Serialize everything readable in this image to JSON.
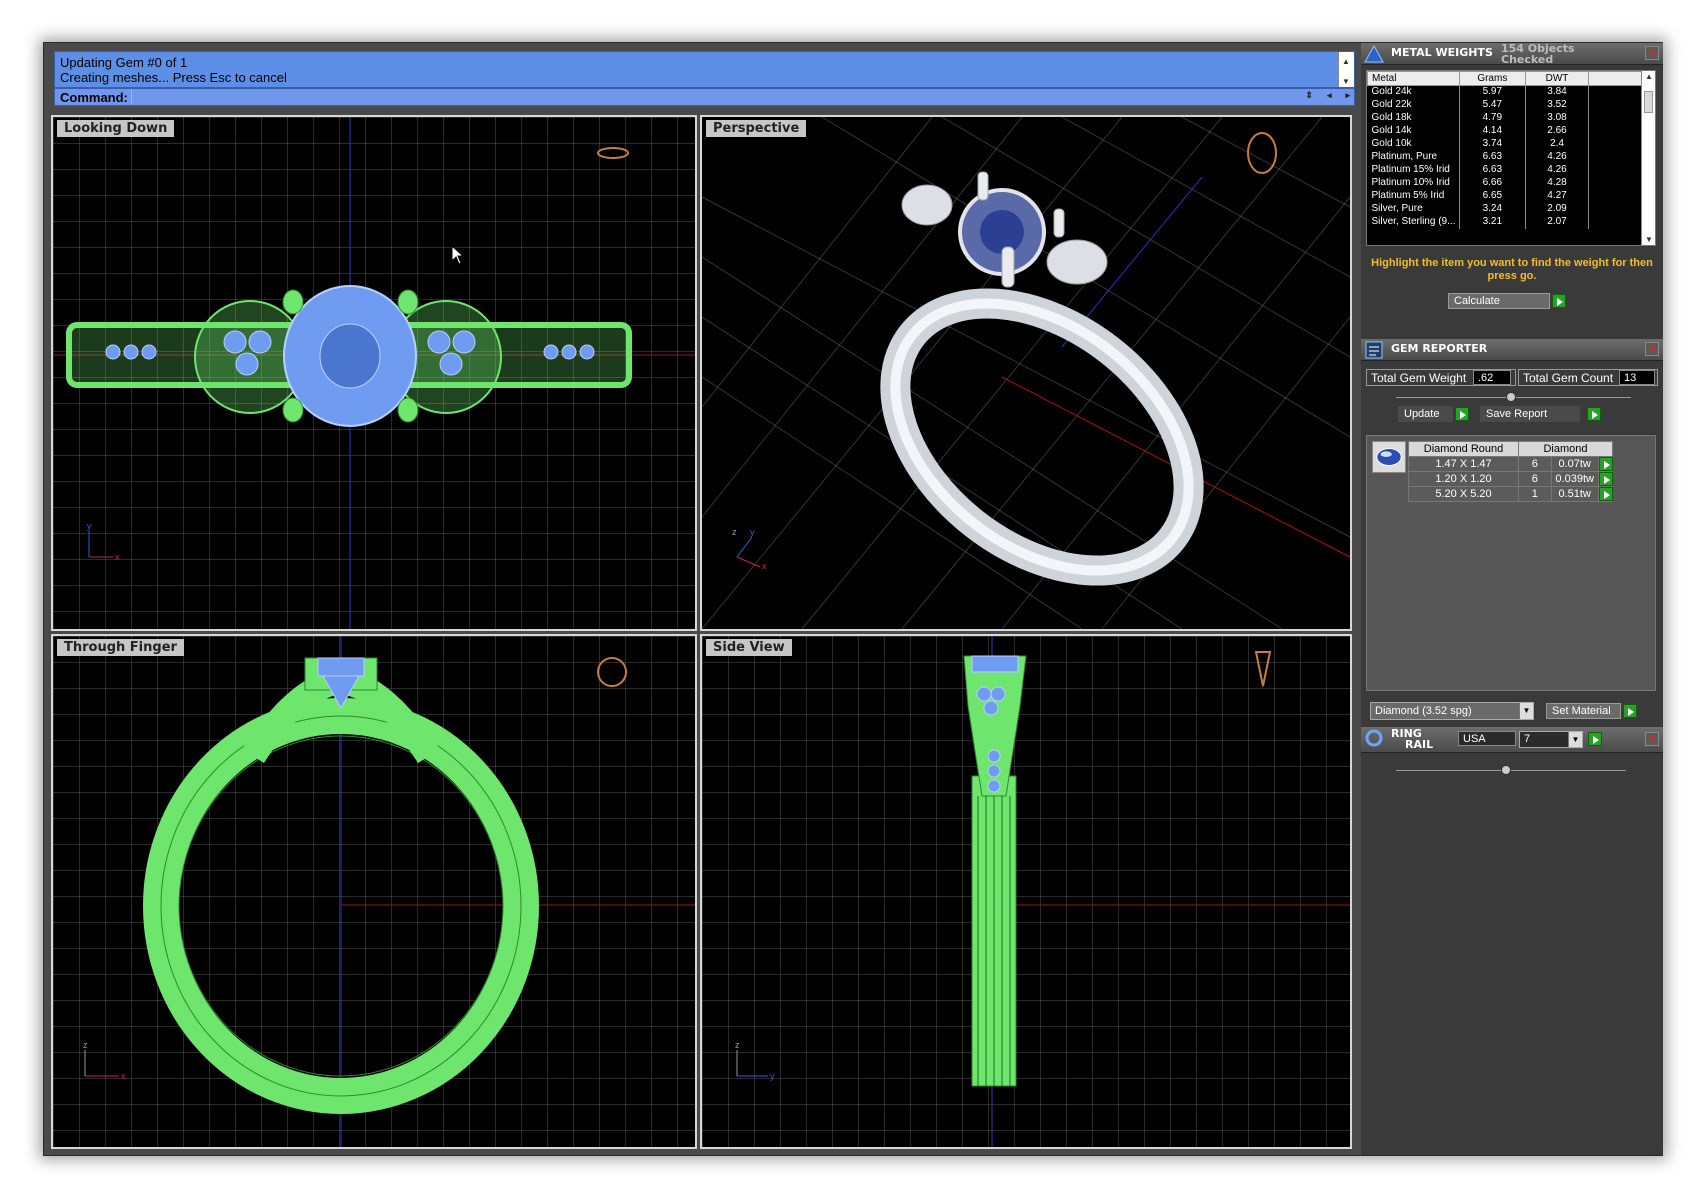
{
  "command": {
    "history": [
      "Updating Gem #0 of 1",
      "Creating meshes... Press Esc to cancel"
    ],
    "prompt": "Command:"
  },
  "viewports": {
    "top_left": "Looking Down",
    "top_right": "Perspective",
    "bottom_left": "Through Finger",
    "bottom_right": "Side View"
  },
  "axes": {
    "x": "x",
    "y": "y",
    "z": "z"
  },
  "metal_weights": {
    "title": "METAL WEIGHTS",
    "subtitle": [
      "154 Objects",
      "Checked"
    ],
    "columns": [
      "Metal",
      "Grams",
      "DWT"
    ],
    "rows": [
      {
        "metal": "Gold 24k",
        "grams": "5.97",
        "dwt": "3.84"
      },
      {
        "metal": "Gold 22k",
        "grams": "5.47",
        "dwt": "3.52"
      },
      {
        "metal": "Gold 18k",
        "grams": "4.79",
        "dwt": "3.08"
      },
      {
        "metal": "Gold 14k",
        "grams": "4.14",
        "dwt": "2.66"
      },
      {
        "metal": "Gold 10k",
        "grams": "3.74",
        "dwt": "2.4"
      },
      {
        "metal": "Platinum, Pure",
        "grams": "6.63",
        "dwt": "4.26"
      },
      {
        "metal": "Platinum 15% Irid",
        "grams": "6.63",
        "dwt": "4.26"
      },
      {
        "metal": "Platinum 10% Irid",
        "grams": "6.66",
        "dwt": "4.28"
      },
      {
        "metal": "Platinum 5% Irid",
        "grams": "6.65",
        "dwt": "4.27"
      },
      {
        "metal": "Silver, Pure",
        "grams": "3.24",
        "dwt": "2.09"
      },
      {
        "metal": "Silver, Sterling (9...",
        "grams": "3.21",
        "dwt": "2.07"
      }
    ],
    "hint": "Highlight the item you want to find the weight for then press go.",
    "calculate_label": "Calculate"
  },
  "gem_reporter": {
    "title": "GEM REPORTER",
    "total_weight_label": "Total Gem Weight",
    "total_weight_value": ".62",
    "total_count_label": "Total Gem Count",
    "total_count_value": "13",
    "update_label": "Update",
    "save_label": "Save Report",
    "columns": [
      "Diamond Round",
      "Diamond"
    ],
    "rows": [
      {
        "size": "1.47 X 1.47",
        "count": "6",
        "tw": "0.07tw"
      },
      {
        "size": "1.20 X 1.20",
        "count": "6",
        "tw": "0.039tw"
      },
      {
        "size": "5.20 X 5.20",
        "count": "1",
        "tw": "0.51tw"
      }
    ],
    "material_value": "Diamond     (3.52 spg)",
    "set_material_label": "Set Material"
  },
  "ring_rail": {
    "title_line1": "RING",
    "title_line2": "RAIL",
    "country": "USA",
    "size": "7"
  }
}
